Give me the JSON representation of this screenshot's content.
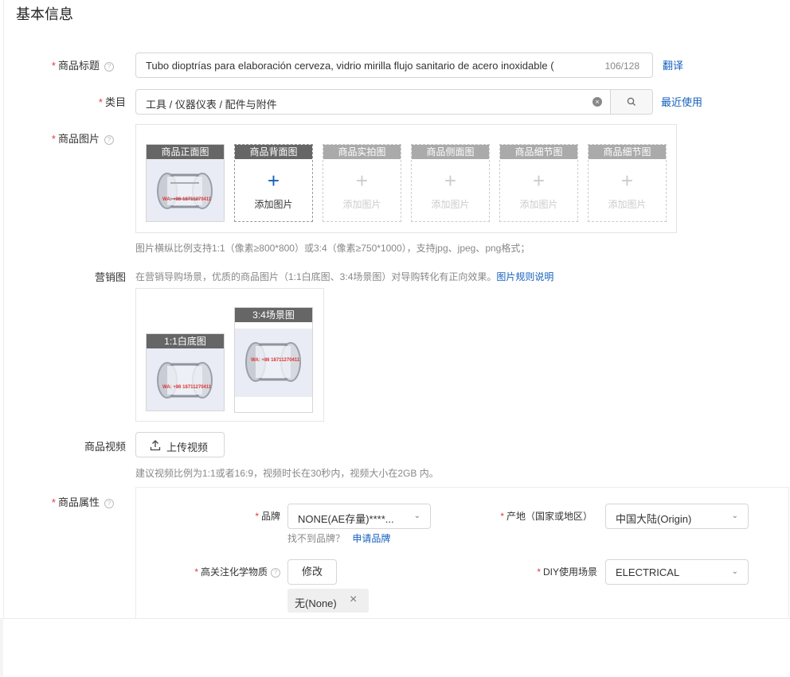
{
  "section": {
    "title": "基本信息"
  },
  "product_title": {
    "label": "商品标题",
    "value": "Tubo  dioptrías para elaboración  cerveza, vidrio  mirilla  flujo sanitario de acero inoxidable (",
    "counter": "106/128",
    "translate_link": "翻译"
  },
  "category": {
    "label": "类目",
    "value": "工具 / 仪器仪表 / 配件与附件",
    "recent_link": "最近使用"
  },
  "images": {
    "label": "商品图片",
    "add_text": "添加图片",
    "slots": [
      {
        "title": "商品正面图",
        "state": "filled"
      },
      {
        "title": "商品背面图",
        "state": "active"
      },
      {
        "title": "商品实拍图",
        "state": "disabled"
      },
      {
        "title": "商品侧面图",
        "state": "disabled"
      },
      {
        "title": "商品细节图",
        "state": "disabled"
      },
      {
        "title": "商品细节图",
        "state": "disabled"
      }
    ],
    "hint": "图片横纵比例支持1:1（像素≥800*800）或3:4（像素≥750*1000），支持jpg、jpeg、png格式；",
    "watermark": "WA: +86 18711270411"
  },
  "marketing": {
    "label": "营销图",
    "hint": "在营销导购场景，优质的商品图片（1:1白底图、3:4场景图）对导购转化有正向效果。",
    "rules_link": "图片规则说明",
    "cards": [
      {
        "title": "1:1白底图"
      },
      {
        "title": "3:4场景图"
      }
    ]
  },
  "video": {
    "label": "商品视频",
    "upload_button": "上传视频",
    "hint": "建议视频比例为1:1或者16:9，视频时长在30秒内，视频大小在2GB 内。"
  },
  "attributes": {
    "label": "商品属性",
    "brand": {
      "label": "品牌",
      "value": "NONE(AE存量)****...",
      "not_found": "找不到品牌？",
      "apply_link": "申请品牌"
    },
    "origin": {
      "label": "产地（国家或地区）",
      "value": "中国大陆(Origin)"
    },
    "chemical": {
      "label": "高关注化学物质",
      "modify_button": "修改",
      "tag": "无(None)"
    },
    "diy": {
      "label": "DIY使用场景",
      "value": "ELECTRICAL"
    }
  },
  "colors": {
    "required": "#e4393c",
    "link": "#1560bd",
    "card_header": "#666666",
    "plus_active": "#1560bd"
  }
}
